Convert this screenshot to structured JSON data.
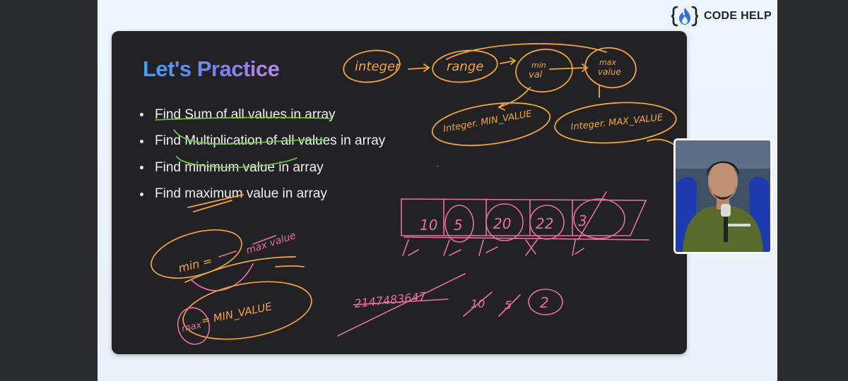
{
  "brand": {
    "name": "CODE HELP",
    "icon": "flame-braces-icon",
    "accent": "#2f6fd6"
  },
  "slide": {
    "title": "Let's Practice",
    "bullets": [
      "Find Sum of all values in array",
      "Find Multiplication of all values in array",
      "Find minimum value in array",
      "Find maximum value in array"
    ]
  },
  "annotations": {
    "integer": "integer",
    "range": "range",
    "min_val_1": "min",
    "min_val_2": "val",
    "max_val_1": "max",
    "max_val_2": "value",
    "int_min": "Integer. MIN_VALUE",
    "int_max": "Integer. MAX_VALUE",
    "array_values": [
      "10",
      "5",
      "20",
      "22",
      "3"
    ],
    "min_expr": "min =",
    "max_value_note": "max value",
    "max_expr_1": "max",
    "max_expr_2": "= MIN_VALUE",
    "big_number": "2147483647",
    "crossed_10": "10",
    "crossed_5": "5",
    "result": "2",
    "colors": {
      "orange": "#f1a53d",
      "pink": "#e9709c",
      "green": "#6fcf43"
    }
  },
  "webcam": {
    "icon": "presenter-video"
  }
}
